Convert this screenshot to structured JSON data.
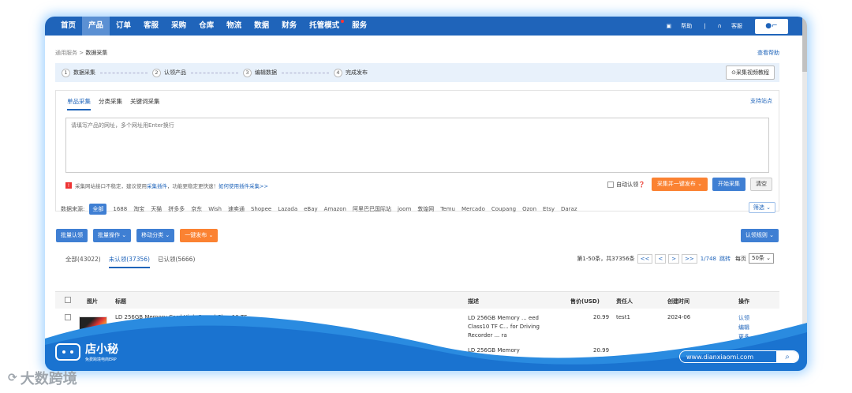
{
  "nav": {
    "items": [
      "首页",
      "产品",
      "订单",
      "客服",
      "采购",
      "仓库",
      "物流",
      "数据",
      "财务",
      "托管模式",
      "服务"
    ],
    "active_index": 1,
    "help": "帮助",
    "service": "客服"
  },
  "breadcrumb": {
    "parent": "通用服务",
    "current": "数据采集"
  },
  "help_link": "查看帮助",
  "steps": [
    {
      "num": "1",
      "label": "数据采集"
    },
    {
      "num": "2",
      "label": "认领产品"
    },
    {
      "num": "3",
      "label": "编辑数据"
    },
    {
      "num": "4",
      "label": "完成发布"
    }
  ],
  "video_tutorial": "采集视频教程",
  "collect_tabs": [
    "单品采集",
    "分类采集",
    "关键词采集"
  ],
  "support_sites": "支持站点",
  "url_placeholder": "请填写产品的网址，多个网址用Enter换行",
  "warning": {
    "text": "采集网站接口不稳定，建议使用",
    "plugin": "采集插件",
    "text2": "，功能更稳定更快速！",
    "howto": "如何使用插件采集>>"
  },
  "actions": {
    "auto_claim": "自动认领",
    "collect_publish": "采集并一键发布",
    "start": "开始采集",
    "clear": "清空"
  },
  "sources": {
    "label": "数据来源:",
    "items": [
      "全部",
      "1688",
      "淘宝",
      "天猫",
      "拼多多",
      "京东",
      "Wish",
      "速卖通",
      "Shopee",
      "Lazada",
      "eBay",
      "Amazon",
      "阿里巴巴国际站",
      "joom",
      "敦煌网",
      "Temu",
      "Mercado",
      "Coupang",
      "Ozon",
      "Etsy",
      "Daraz"
    ],
    "filter": "筛选"
  },
  "toolbar": {
    "bulk_claim": "批量认领",
    "bulk_ops": "批量操作",
    "move_category": "移动分类",
    "one_click_publish": "一键发布",
    "claim_rules": "认领规则"
  },
  "status_tabs": [
    "全部(43022)",
    "未认领(37356)",
    "已认领(5666)"
  ],
  "pager": {
    "summary": "第1-50条，共37356条",
    "page": "1/748",
    "jump": "跳转",
    "per_page_label": "每页",
    "per_page": "50条"
  },
  "table": {
    "headers": [
      "图片",
      "标题",
      "描述",
      "售价(USD)",
      "责任人",
      "创建时间",
      "操作"
    ],
    "rows": [
      {
        "title": "LD 256GB Memory Card High-Speed Class10 TF",
        "description": "LD 256GB Memory ... eed Class10 TF C... for Driving Recorder ... ra",
        "price": "20.99",
        "owner": "test1",
        "created": "2024-06",
        "ops": [
          "认领",
          "编辑",
          "更多"
        ]
      },
      {
        "title": "",
        "description": "LD 256GB Memory",
        "price": "20.99",
        "owner": "",
        "created": "",
        "ops": []
      }
    ]
  },
  "brand": {
    "name": "店小秘",
    "slogan": "免费跨境电商ERP",
    "url": "www.dianxiaomi.com"
  },
  "watermark": "大数跨境"
}
